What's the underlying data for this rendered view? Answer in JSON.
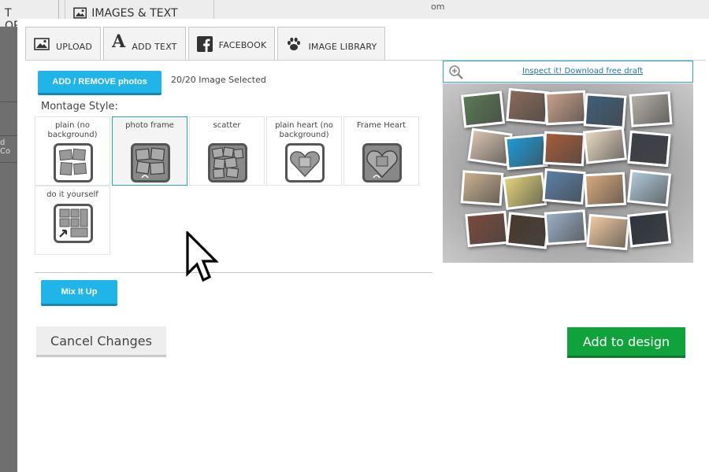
{
  "background": {
    "tab1": "T OPTIONS",
    "tab2": "IMAGES & TEXT TOOLS",
    "misc": "om",
    "left_text": "d Co"
  },
  "tabs": [
    {
      "label": "UPLOAD",
      "icon": "image-icon"
    },
    {
      "label": "ADD TEXT",
      "icon": "text-a-icon"
    },
    {
      "label": "FACEBOOK",
      "icon": "facebook-icon"
    },
    {
      "label": "IMAGE LIBRARY",
      "icon": "paw-icon"
    }
  ],
  "photos": {
    "add_remove_label": "ADD / REMOVE photos",
    "selected_count": "20/20 Image Selected"
  },
  "montage": {
    "label": "Montage Style:",
    "styles": [
      {
        "label": "plain (no background)",
        "selected": false,
        "icon": "plain-collage-icon"
      },
      {
        "label": "photo frame",
        "selected": true,
        "icon": "photo-frame-collage-icon"
      },
      {
        "label": "scatter",
        "selected": false,
        "icon": "scatter-collage-icon"
      },
      {
        "label": "plain heart (no background)",
        "selected": false,
        "icon": "heart-collage-icon"
      },
      {
        "label": "Frame Heart",
        "selected": false,
        "icon": "frame-heart-collage-icon"
      },
      {
        "label": "do it yourself",
        "selected": false,
        "icon": "diy-collage-icon"
      }
    ]
  },
  "mix_label": "Mix It Up",
  "cancel_label": "Cancel Changes",
  "add_label": "Add to design",
  "preview": {
    "inspect_link": "Inspect it! Download free draft",
    "photo_colors": [
      "#5a7a54",
      "#8a6a5a",
      "#c9a08a",
      "#3e5f7a",
      "#b6b1a8",
      "#d7c3b0",
      "#1c9ad6",
      "#a65c3a",
      "#e8d8c0",
      "#3c3f48",
      "#c8b08f",
      "#e0d27a",
      "#5a7fa8",
      "#d9a97c",
      "#b0c8d8",
      "#7a4a3a",
      "#4a3a2c",
      "#9ab0c6",
      "#f0c8a0",
      "#2e3440"
    ]
  },
  "colors": {
    "accent_blue": "#1fb5e9",
    "add_green": "#10a33b",
    "link_blue": "#1a73b8"
  }
}
